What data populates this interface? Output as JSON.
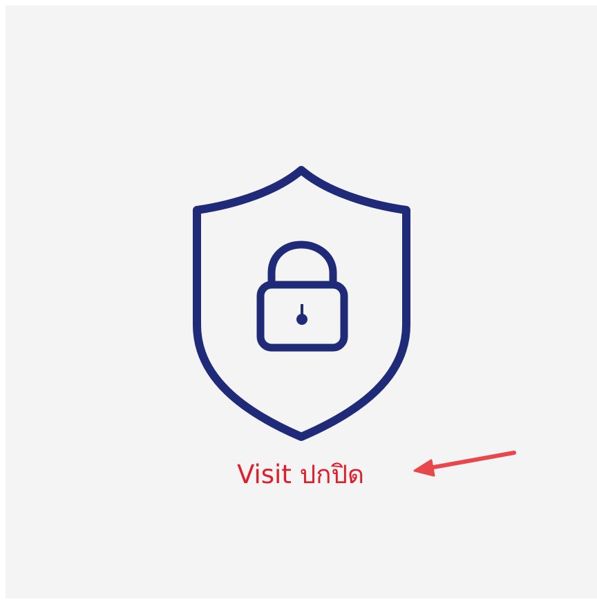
{
  "caption": {
    "text": "Visit ปกปิด"
  },
  "colors": {
    "background": "#f4f4f5",
    "icon_stroke": "#1f2a78",
    "caption_text": "#e11d2a",
    "arrow": "#e8474b"
  },
  "icons": {
    "main": "shield-lock-icon",
    "pointer": "red-arrow-icon"
  }
}
